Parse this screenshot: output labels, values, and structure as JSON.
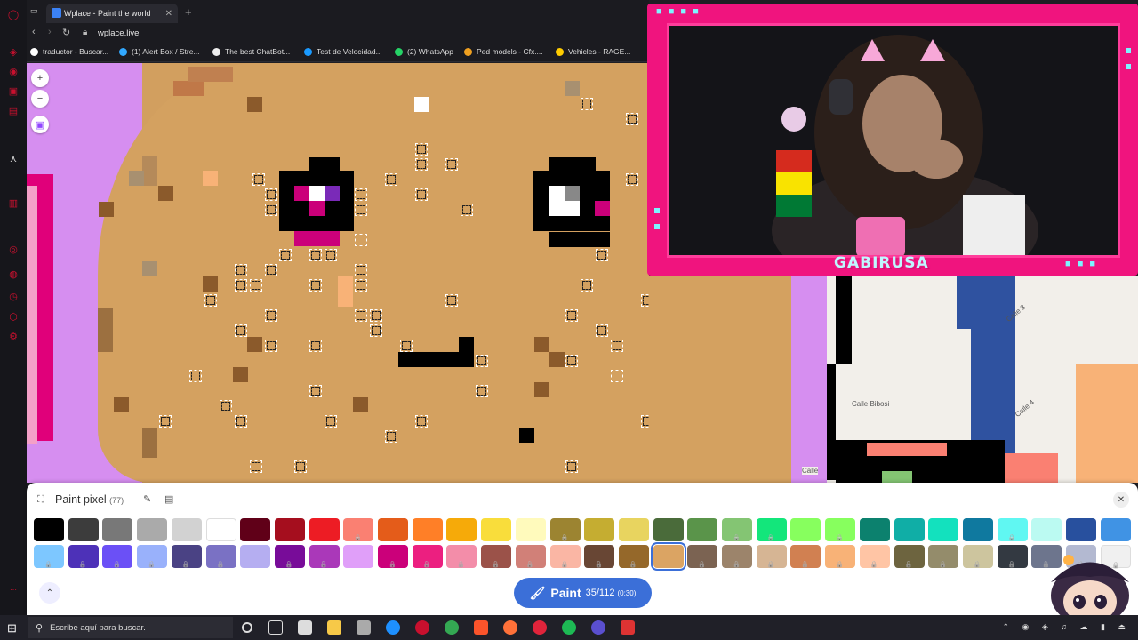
{
  "browser": {
    "tab_title": "Wplace - Paint the world",
    "url": "wplace.live",
    "bookmarks": [
      "traductor - Buscar...",
      "(1) Alert Box / Stre...",
      "The best ChatBot...",
      "Test de Velocidad...",
      "(2) WhatsApp",
      "Ped models - Cfx....",
      "Vehicles - RAGE..."
    ]
  },
  "webcam": {
    "name": "GABIRUSA"
  },
  "map": {
    "streets": [
      "Calle 3",
      "Calle Bibosi",
      "Calle 4",
      "Calle"
    ]
  },
  "panel": {
    "title": "Paint pixel",
    "count": "(77)",
    "paint_label": "Paint",
    "charges": "35/112",
    "timer": "(0:30)"
  },
  "palette": {
    "row1": [
      "#000000",
      "#3c3c3c",
      "#787878",
      "#aaaaaa",
      "#d2d2d2",
      "#ffffff",
      "#600018",
      "#a50e1e",
      "#ed1c24",
      "#fa8072",
      "#e45c1a",
      "#ff7f27",
      "#f6aa09",
      "#f9dd3b",
      "#fffabc",
      "#9c8431",
      "#c5ad31",
      "#e8d45f",
      "#4a6b3a",
      "#5a944a",
      "#84c573",
      "#13e67b",
      "#87ff5e",
      "#87ff5e",
      "#0c816e",
      "#10aea6",
      "#13e1be",
      "#0f799f",
      "#60f7f2",
      "#bbfaf2",
      "#28509e",
      "#4093e4"
    ],
    "row2": [
      "#7dc7ff",
      "#4d31b8",
      "#6b50f6",
      "#99b1fb",
      "#4a4284",
      "#7a71c4",
      "#b5aef1",
      "#780c99",
      "#aa38b9",
      "#e09ff9",
      "#cb007a",
      "#ec1f80",
      "#f38da9",
      "#9b5249",
      "#d18078",
      "#fab6a4",
      "#684634",
      "#95682a",
      "#dba463",
      "#7b6352",
      "#9c846b",
      "#d6b594",
      "#d18051",
      "#f8b277",
      "#ffc5a5",
      "#6d643f",
      "#948c6b",
      "#cdc59e",
      "#333941",
      "#6d758d",
      "#b3b9d1",
      "#f0f0f0"
    ],
    "selected_row": 2,
    "selected_index": 18
  },
  "taskbar": {
    "search_placeholder": "Escribe aquí para buscar."
  }
}
